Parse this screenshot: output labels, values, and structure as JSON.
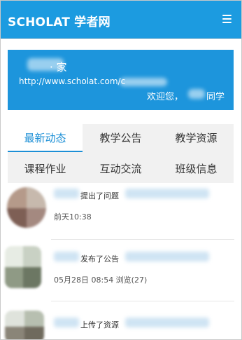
{
  "header": {
    "brand": "SCHOLAT 学者网",
    "menu_icon": "hamburger-menu-icon"
  },
  "banner": {
    "name": "· 家",
    "url": "http://www.scholat.com/c",
    "welcome": "欢迎您，",
    "student_suffix": "同学"
  },
  "tabs": [
    {
      "label": "最新动态"
    },
    {
      "label": "教学公告"
    },
    {
      "label": "教学资源"
    },
    {
      "label": "课程作业"
    },
    {
      "label": "互动交流"
    },
    {
      "label": "班级信息"
    }
  ],
  "feed": [
    {
      "action": "提出了问题",
      "meta": "前天10:38"
    },
    {
      "action": "发布了公告",
      "meta": "05月28日 08:54 浏览(27)"
    },
    {
      "action": "上传了资源",
      "meta": ""
    }
  ]
}
